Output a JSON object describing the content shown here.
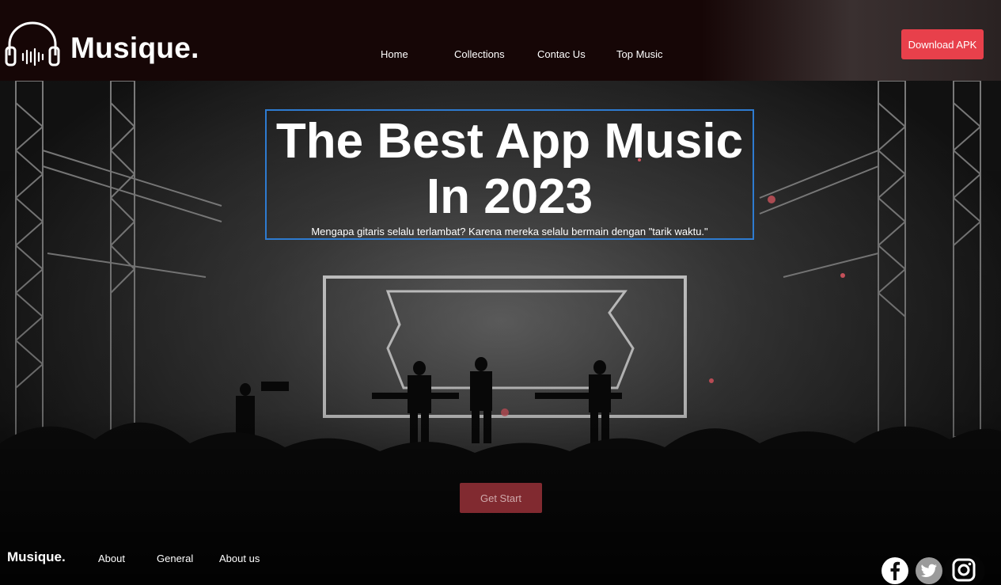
{
  "header": {
    "brand": "Musique.",
    "nav": [
      {
        "label": "Home"
      },
      {
        "label": "Collections"
      },
      {
        "label": "Contac Us"
      },
      {
        "label": "Top Music"
      }
    ],
    "download_label": "Download APK"
  },
  "hero": {
    "title_line1": "The Best App Music",
    "title_line2": "In 2023",
    "subtitle": "Mengapa gitaris selalu terlambat? Karena mereka selalu bermain dengan \"tarik waktu.\"",
    "cta_label": "Get Start"
  },
  "footer": {
    "brand": "Musique.",
    "links": [
      {
        "label": "About"
      },
      {
        "label": "General"
      },
      {
        "label": "About us"
      }
    ],
    "social": [
      {
        "icon": "facebook-icon"
      },
      {
        "icon": "twitter-icon"
      },
      {
        "icon": "instagram-icon"
      }
    ]
  },
  "colors": {
    "accent": "#e8404b",
    "cta": "#812a30",
    "header_bg": "#160606",
    "hero_border": "#2e7bd0"
  }
}
